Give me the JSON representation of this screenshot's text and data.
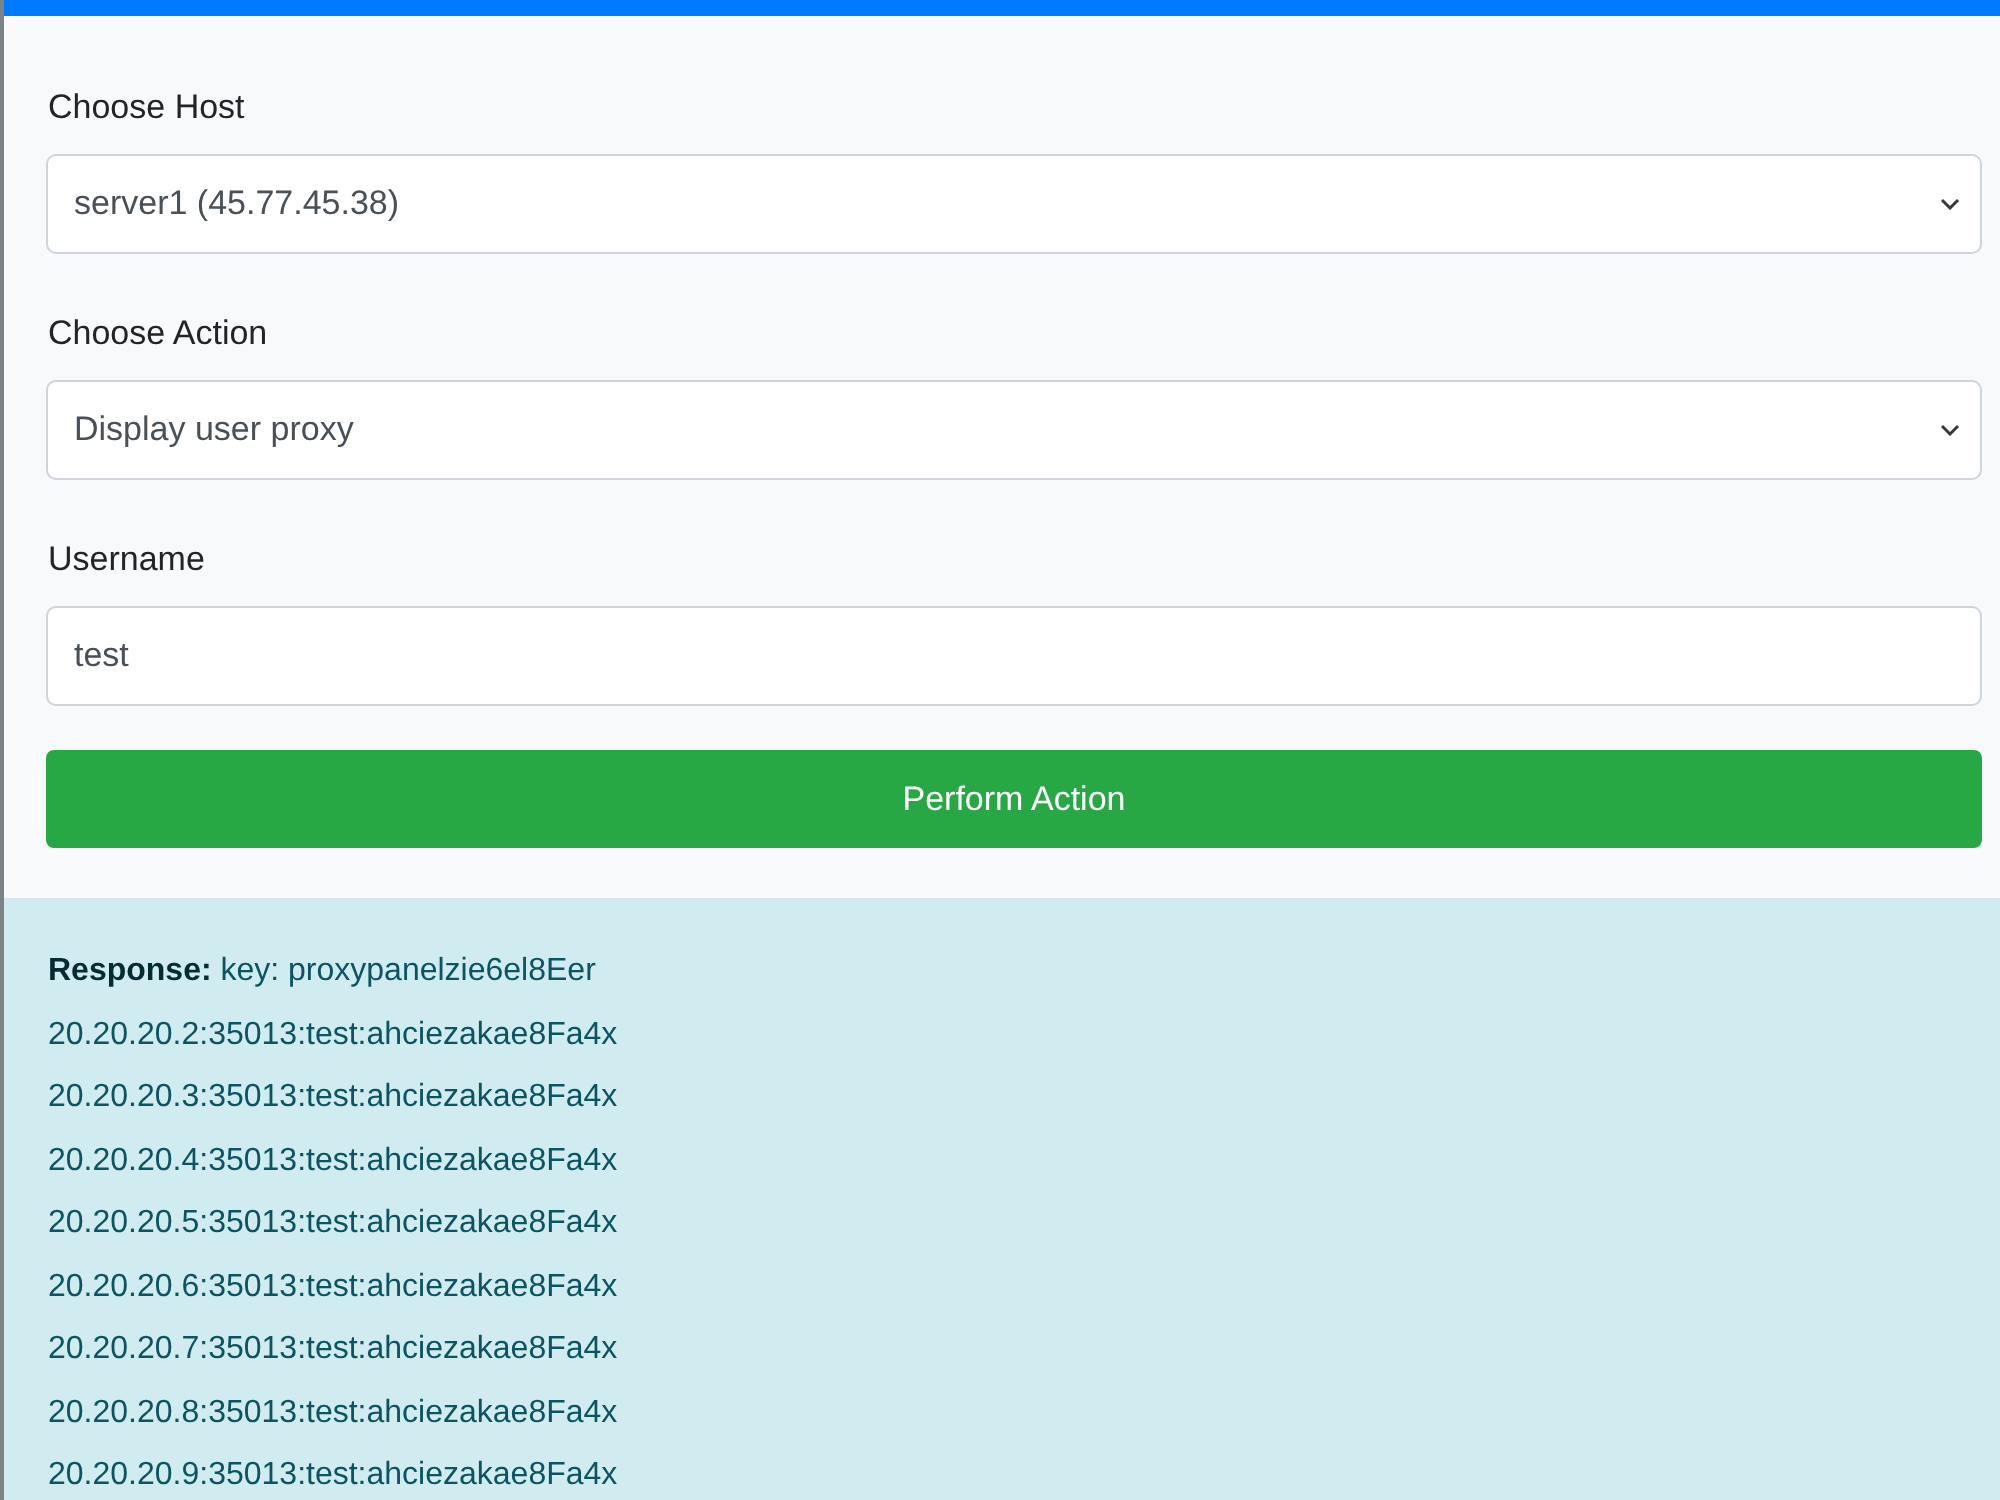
{
  "form": {
    "fields": [
      {
        "kind": "select",
        "label": "Choose Host",
        "value": "server1 (45.77.45.38)"
      },
      {
        "kind": "select",
        "label": "Choose Action",
        "value": "Display user proxy"
      },
      {
        "kind": "text",
        "label": "Username",
        "value": "test"
      }
    ],
    "submit_button": "Perform Action"
  },
  "response": {
    "heading_line": "**Response:** key: proxypanelzie6el8Eer",
    "lines": [
      "20.20.20.2:35013:test:ahciezakae8Fa4x",
      "20.20.20.3:35013:test:ahciezakae8Fa4x",
      "20.20.20.4:35013:test:ahciezakae8Fa4x",
      "20.20.20.5:35013:test:ahciezakae8Fa4x",
      "20.20.20.6:35013:test:ahciezakae8Fa4x",
      "20.20.20.7:35013:test:ahciezakae8Fa4x",
      "20.20.20.8:35013:test:ahciezakae8Fa4x",
      "20.20.20.9:35013:test:ahciezakae8Fa4x"
    ]
  }
}
